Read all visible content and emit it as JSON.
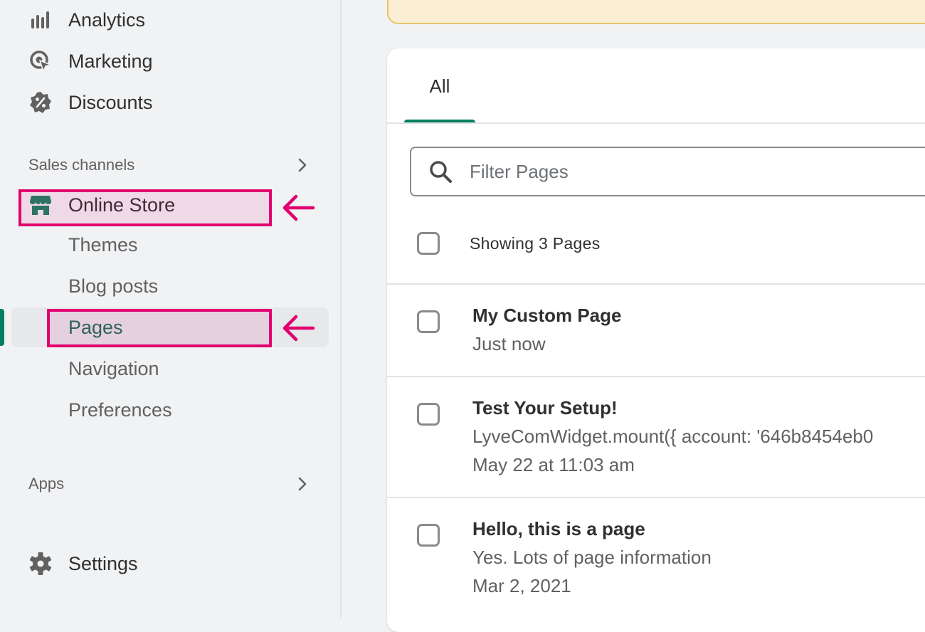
{
  "sidebar": {
    "items": [
      {
        "label": "Analytics",
        "icon": "analytics-icon"
      },
      {
        "label": "Marketing",
        "icon": "marketing-icon"
      },
      {
        "label": "Discounts",
        "icon": "discounts-icon"
      }
    ],
    "sales_channels": {
      "heading": "Sales channels",
      "online_store": {
        "label": "Online Store",
        "icon": "store-icon"
      },
      "sub_items": [
        {
          "label": "Themes"
        },
        {
          "label": "Blog posts"
        },
        {
          "label": "Pages",
          "active": true
        },
        {
          "label": "Navigation"
        },
        {
          "label": "Preferences"
        }
      ]
    },
    "apps": {
      "heading": "Apps"
    },
    "settings": {
      "label": "Settings",
      "icon": "gear-icon"
    }
  },
  "main": {
    "tabs": [
      {
        "label": "All",
        "selected": true
      }
    ],
    "search": {
      "placeholder": "Filter Pages",
      "value": ""
    },
    "showing_text": "Showing 3 Pages",
    "pages": [
      {
        "title": "My Custom Page",
        "lines": [
          "Just now"
        ]
      },
      {
        "title": "Test Your Setup!",
        "lines": [
          "LyveComWidget.mount({ account: '646b8454eb0",
          "May 22 at 11:03 am"
        ]
      },
      {
        "title": "Hello, this is a page",
        "lines": [
          "Yes. Lots of page information",
          "Mar 2, 2021"
        ]
      }
    ]
  },
  "colors": {
    "accent": "#008060",
    "highlight": "#e0006e",
    "banner": "#faefd4"
  }
}
